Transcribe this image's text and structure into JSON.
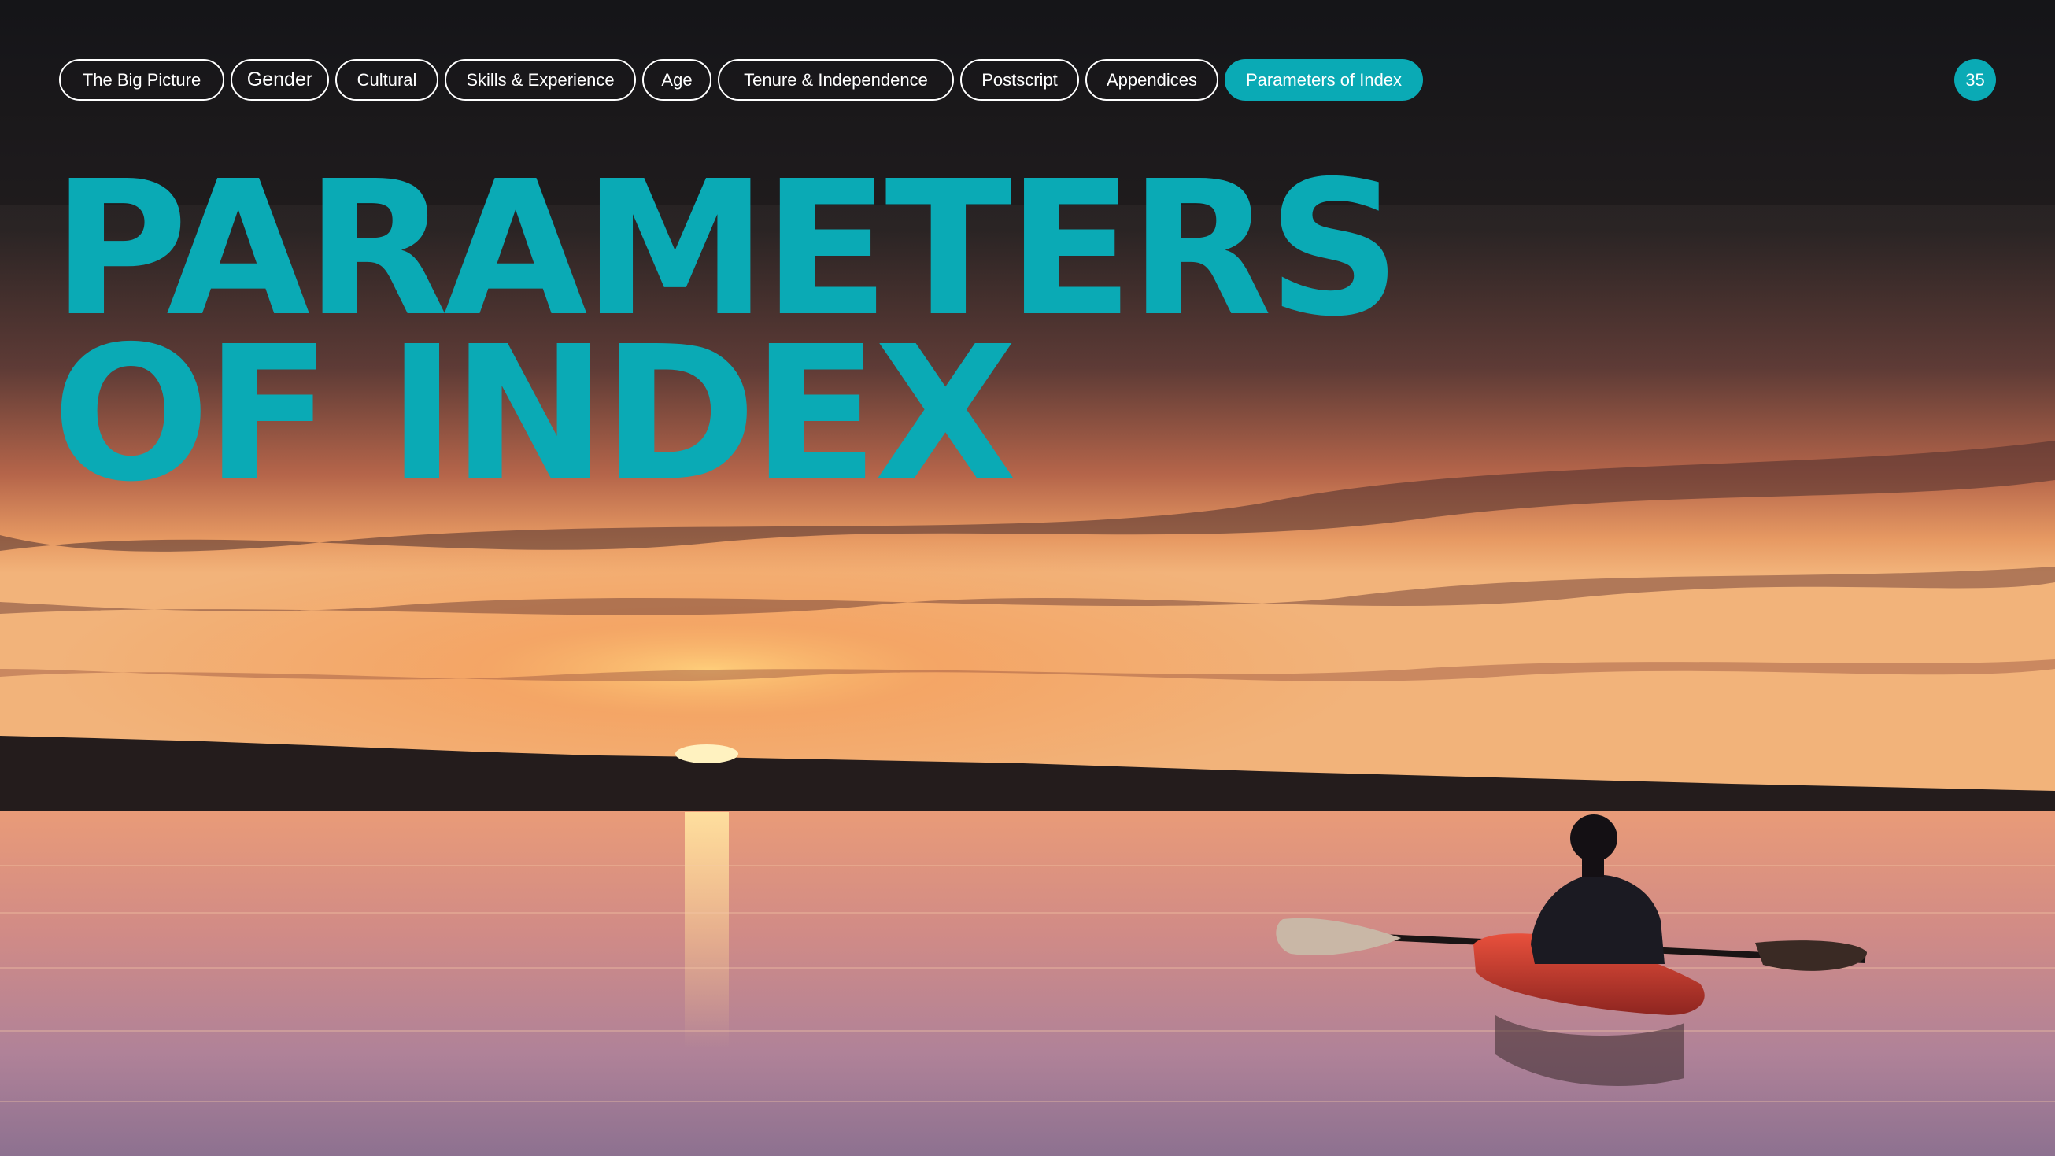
{
  "nav": {
    "items": [
      {
        "label": "The Big Picture",
        "active": false
      },
      {
        "label": "Gender",
        "active": false
      },
      {
        "label": "Cultural",
        "active": false
      },
      {
        "label": "Skills & Experience",
        "active": false
      },
      {
        "label": "Age",
        "active": false
      },
      {
        "label": "Tenure & Independence",
        "active": false
      },
      {
        "label": "Postscript",
        "active": false
      },
      {
        "label": "Appendices",
        "active": false
      },
      {
        "label": "Parameters of Index",
        "active": true
      }
    ]
  },
  "page_number": "35",
  "title": {
    "line1": "PARAMETERS",
    "line2": "OF INDEX"
  },
  "colors": {
    "accent": "#0aaab5",
    "pill_border": "#ffffff",
    "text": "#ffffff"
  },
  "background": {
    "scene": "sunset-lake-kayaker-photo"
  }
}
